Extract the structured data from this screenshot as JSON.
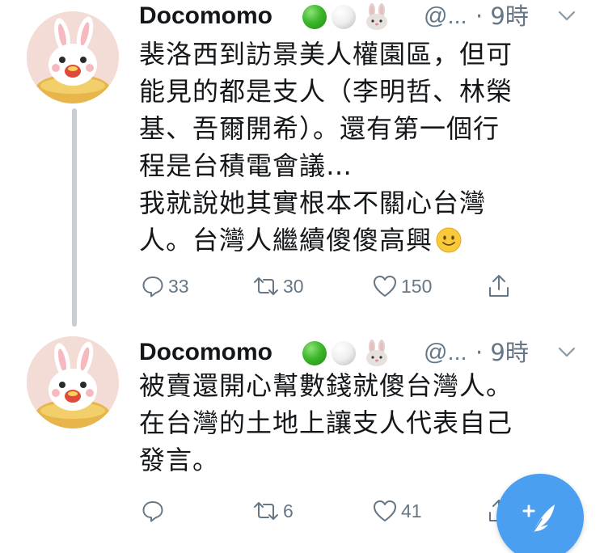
{
  "tweets": [
    {
      "display_name": "Docomomo",
      "badges": [
        "green-circle-emoji",
        "white-circle-emoji",
        "rabbit-face-emoji"
      ],
      "handle": "@...",
      "time": "· 9時",
      "body_lines": [
        "裴洛西到訪景美人權園區，但可",
        "能見的都是支人（李明哲、林榮",
        "基、吾爾開希）。還有第一個行",
        "程是台積電會議…",
        "我就說她其實根本不關心台灣",
        "人。台灣人繼續傻傻高興"
      ],
      "trailing_emoji": "slightly-smiling-face-emoji",
      "replies": "33",
      "retweets": "30",
      "likes": "150"
    },
    {
      "display_name": "Docomomo",
      "badges": [
        "green-circle-emoji",
        "white-circle-emoji",
        "rabbit-face-emoji"
      ],
      "handle": "@...",
      "time": "· 9時",
      "body_lines": [
        "被賣還開心幫數錢就傻台灣人。",
        "在台灣的土地上讓支人代表自己",
        "發言。"
      ],
      "replies": "",
      "retweets": "6",
      "likes": "41"
    }
  ],
  "fab": {
    "icon": "compose-feather-icon"
  },
  "colors": {
    "text": "#14171a",
    "secondary": "#657786",
    "thread_line": "#c8ced4",
    "fab": "#4a9ff0"
  }
}
